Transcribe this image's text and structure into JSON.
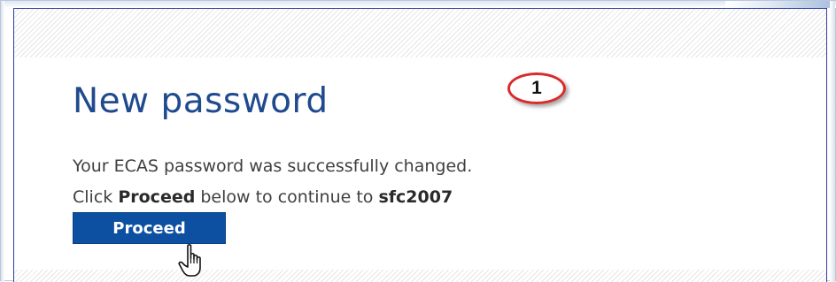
{
  "page": {
    "title": "New password",
    "callout_number": "1"
  },
  "message": {
    "line1": "Your ECAS password was successfully changed.",
    "line2_prefix": "Click ",
    "line2_action": "Proceed",
    "line2_middle": " below to continue to ",
    "line2_target": "sfc2007"
  },
  "actions": {
    "proceed_label": "Proceed"
  },
  "colors": {
    "title": "#1f4a8e",
    "button_bg": "#0d4fa1",
    "callout_border": "#d92b2b",
    "panel_border": "#2f3ea3"
  },
  "icons": {
    "cursor": "hand-pointer-icon",
    "callout": "numbered-callout"
  }
}
